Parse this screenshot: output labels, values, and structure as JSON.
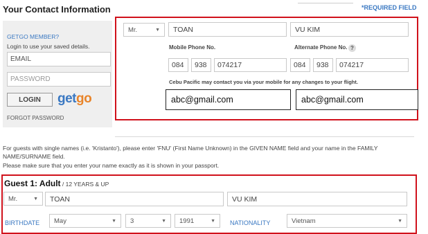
{
  "header": {
    "title": "Your Contact Information",
    "required_note": "*REQUIRED FIELD"
  },
  "login_panel": {
    "member_label": "GETGO MEMBER?",
    "hint": "Login to use your saved details.",
    "email_placeholder": "EMAIL",
    "password_placeholder": "PASSWORD",
    "login_label": "LOGIN",
    "logo_part1": "get",
    "logo_part2": "go",
    "forgot_label": "FORGOT PASSWORD"
  },
  "contact": {
    "title_value": "Mr.",
    "first_name": "TOAN",
    "last_name": "VU KIM",
    "mobile_label": "Mobile Phone No.",
    "alternate_label": "Alternate Phone No.",
    "info_icon": "?",
    "mobile": {
      "country": "084",
      "area": "938",
      "number": "074217"
    },
    "alternate": {
      "country": "084",
      "area": "938",
      "number": "074217"
    },
    "notice": "Cebu Pacific may contact you via your mobile for any changes to your flight.",
    "email": "abc@gmail.com",
    "email_confirm": "abc@gmail.com"
  },
  "guest_note": {
    "line1": "For guests with single names (i.e. 'Kristanto'), please enter 'FNU' (First Name Unknown) in the GIVEN NAME field and your name in the FAMILY",
    "line2": "NAME/SURNAME field.",
    "line3": "Please make sure that you enter your name exactly as it is shown in your passport."
  },
  "guest": {
    "heading": "Guest  1:  Adult",
    "subheading": " / 12 YEARS & UP",
    "title_value": "Mr.",
    "first_name": "TOAN",
    "last_name": "VU KIM",
    "birthdate_label": "BIRTHDATE",
    "month": "May",
    "day": "3",
    "year": "1991",
    "nationality_label": "NATIONALITY",
    "nationality": "Vietnam"
  },
  "colors": {
    "highlight_border": "#d0111b",
    "link_blue": "#3a78c2",
    "logo_orange": "#e8842a"
  }
}
